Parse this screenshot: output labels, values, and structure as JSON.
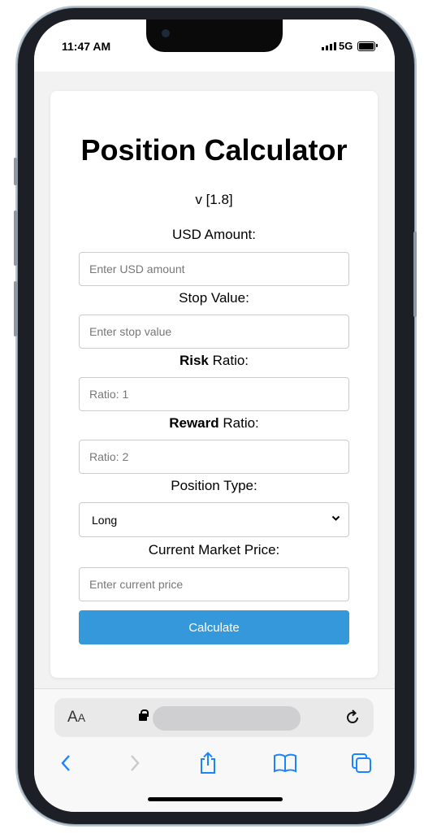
{
  "status_bar": {
    "time": "11:47 AM",
    "network": "5G"
  },
  "calculator": {
    "title": "Position Calculator",
    "version": "v [1.8]",
    "usd": {
      "label": "USD Amount:",
      "placeholder": "Enter USD amount"
    },
    "stop": {
      "label": "Stop Value:",
      "placeholder": "Enter stop value"
    },
    "risk": {
      "label_bold": "Risk",
      "label_rest": " Ratio:",
      "placeholder": "Ratio: 1"
    },
    "reward": {
      "label_bold": "Reward",
      "label_rest": " Ratio:",
      "placeholder": "Ratio: 2"
    },
    "position_type": {
      "label": "Position Type:",
      "selected": "Long"
    },
    "price": {
      "label": "Current Market Price:",
      "placeholder": "Enter current price"
    },
    "calculate_label": "Calculate"
  },
  "browser": {
    "text_size_big": "A",
    "text_size_small": "A",
    "icons": [
      "lock-icon",
      "reload-icon",
      "back-icon",
      "forward-icon",
      "share-icon",
      "bookmarks-icon",
      "tabs-icon"
    ]
  },
  "colors": {
    "accent": "#3598db",
    "nav": "#1a84ff"
  }
}
